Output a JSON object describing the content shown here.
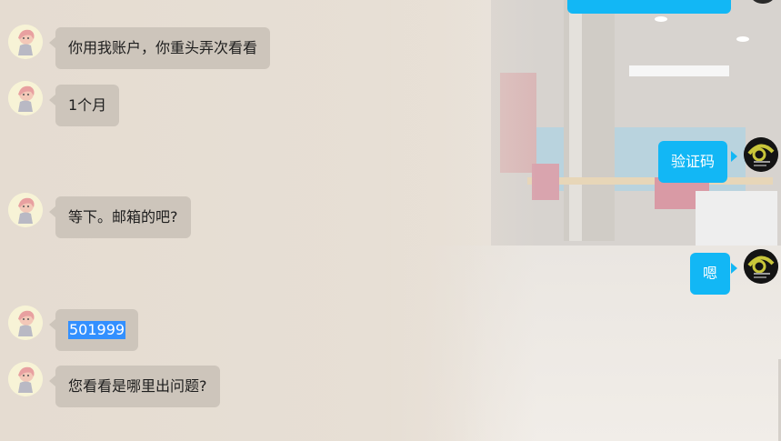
{
  "chat": {
    "messages": [
      {
        "side": "left",
        "text": "你用我账户，你重头弄次看看"
      },
      {
        "side": "left",
        "text": "1个月"
      },
      {
        "side": "right",
        "text": "验证码"
      },
      {
        "side": "left",
        "text": "等下。邮箱的吧?"
      },
      {
        "side": "right",
        "text": "嗯"
      },
      {
        "side": "left",
        "text": "501999",
        "selected": true
      },
      {
        "side": "left",
        "text": "您看看是哪里出问题?"
      }
    ]
  },
  "colors": {
    "left_bubble": "#cdc5bb",
    "right_bubble": "#12b7f5",
    "selection": "#3390ff",
    "background": "#e6ddd2"
  },
  "icons": {
    "left_avatar": "anime-girl-avatar",
    "right_avatar": "dark-logo-avatar"
  }
}
